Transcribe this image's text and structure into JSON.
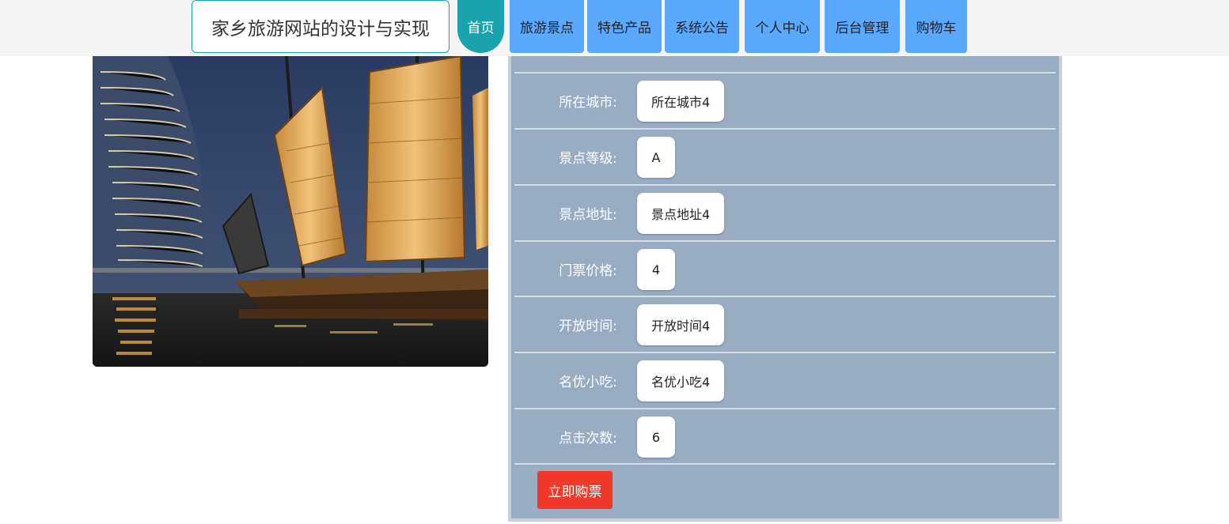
{
  "header": {
    "site_title": "家乡旅游网站的设计与实现",
    "nav": [
      {
        "label": "首页",
        "active": true
      },
      {
        "label": "旅游景点"
      },
      {
        "label": "特色产品"
      },
      {
        "label": "系统公告"
      },
      {
        "label": "个人中心"
      },
      {
        "label": "后台管理"
      },
      {
        "label": "购物车"
      }
    ]
  },
  "details": {
    "rows": [
      {
        "label": "所在城市:",
        "value": "所在城市4"
      },
      {
        "label": "景点等级:",
        "value": "A"
      },
      {
        "label": "景点地址:",
        "value": "景点地址4"
      },
      {
        "label": "门票价格:",
        "value": "4"
      },
      {
        "label": "开放时间:",
        "value": "开放时间4"
      },
      {
        "label": "名优小吃:",
        "value": "名优小吃4"
      },
      {
        "label": "点击次数:",
        "value": "6"
      }
    ],
    "buy_label": "立即购票"
  },
  "colors": {
    "nav_active": "#1aa3ad",
    "nav_item": "#5aa9ff",
    "panel_bg": "#9aacc2",
    "buy_button": "#f0392b"
  }
}
